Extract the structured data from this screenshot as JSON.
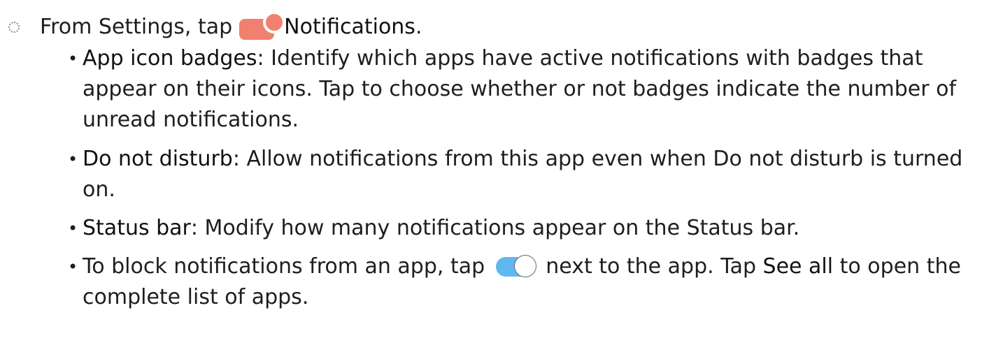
{
  "step": {
    "prefix": "From Settings, tap",
    "icon": "notifications-icon",
    "bold": "Notifications",
    "suffix": "."
  },
  "bullets": [
    {
      "bold": "App icon badges",
      "text": ": Identify which apps have active notifications with badges that appear on their icons. Tap to choose whether or not badges indicate the number of unread notifications."
    },
    {
      "bold": "Do not disturb",
      "text": ": Allow notifications from this app even when Do not disturb is turned on."
    },
    {
      "bold": "Status bar",
      "text": ": Modify how many notifications appear on the Status bar."
    },
    {
      "text_before": "To block notifications from an app, tap",
      "icon": "toggle-switch-icon",
      "text_middle": "next to the app. Tap",
      "bold": "See all",
      "text_after": "to open the complete list of apps."
    }
  ],
  "colors": {
    "notification_icon": "#f08070",
    "toggle_track": "#5fb8f0",
    "text": "#1e1e1e"
  }
}
